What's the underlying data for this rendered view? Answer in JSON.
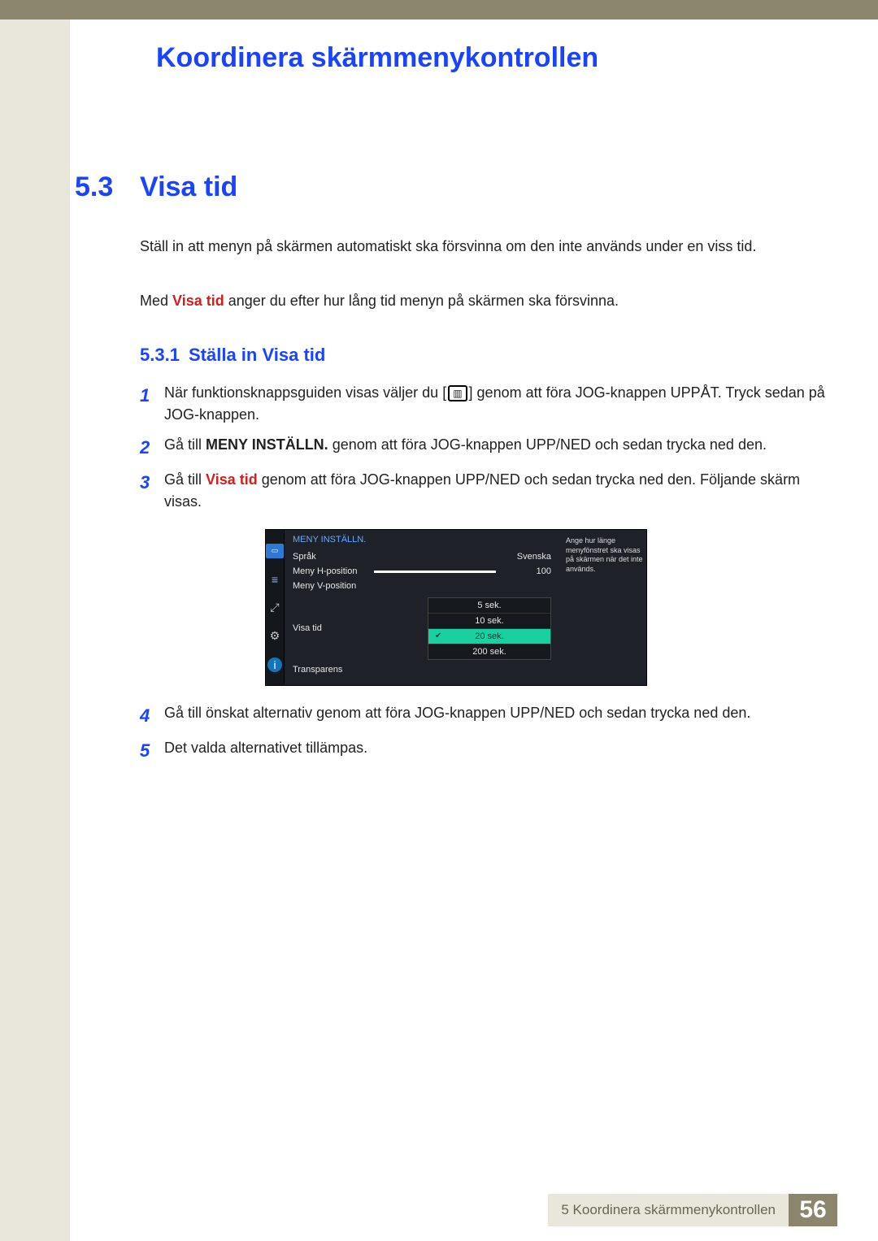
{
  "chapter_title": "Koordinera skärmmenykontrollen",
  "section": {
    "num": "5.3",
    "title": "Visa tid"
  },
  "intro": {
    "p1": "Ställ in att menyn på skärmen automatiskt ska försvinna om den inte används under en viss tid.",
    "p2_prefix": "Med ",
    "p2_highlight": "Visa tid",
    "p2_suffix": " anger du efter hur lång tid menyn på skärmen ska försvinna."
  },
  "subsection": {
    "num": "5.3.1",
    "title": "Ställa in Visa tid"
  },
  "steps": [
    {
      "num": "1",
      "pre": "När funktionsknappsguiden visas väljer du [",
      "post": "] genom att föra JOG-knappen UPPÅT. Tryck sedan på JOG-knappen."
    },
    {
      "num": "2",
      "pre": "Gå till ",
      "bold": "MENY INSTÄLLN.",
      "post": " genom att föra JOG-knappen UPP/NED och sedan trycka ned den."
    },
    {
      "num": "3",
      "pre": "Gå till ",
      "redbold": "Visa tid",
      "post": " genom att föra JOG-knappen UPP/NED och sedan trycka ned den. Följande skärm visas."
    },
    {
      "num": "4",
      "text": "Gå till önskat alternativ genom att föra JOG-knappen UPP/NED och sedan trycka ned den."
    },
    {
      "num": "5",
      "text": "Det valda alternativet tillämpas."
    }
  ],
  "osd": {
    "header": "MENY INSTÄLLN.",
    "rows": {
      "language": {
        "label": "Språk",
        "value": "Svenska"
      },
      "hpos": {
        "label": "Meny H-position",
        "value": "100"
      },
      "vpos": {
        "label": "Meny V-position"
      },
      "display_time": {
        "label": "Visa tid"
      },
      "transparency": {
        "label": "Transparens"
      }
    },
    "options": [
      "5 sek.",
      "10 sek.",
      "20 sek.",
      "200 sek."
    ],
    "selected_index": 2,
    "help": "Ange hur länge menyfönstret ska visas på skärmen när det inte används."
  },
  "footer": {
    "text": "5 Koordinera skärmmenykontrollen",
    "page": "56"
  }
}
